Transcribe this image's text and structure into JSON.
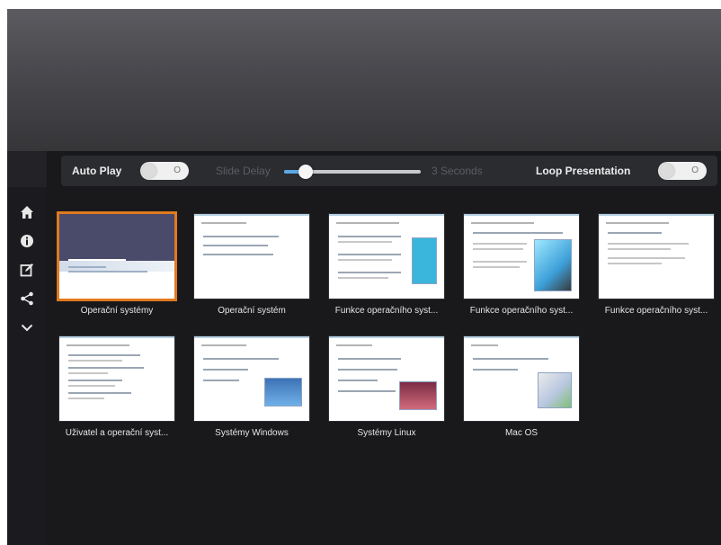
{
  "controls": {
    "auto_play_label": "Auto Play",
    "auto_play_state": "O",
    "slide_delay_label": "Slide Delay",
    "slide_delay_value": "3 Seconds",
    "slide_delay_level": 0.16,
    "loop_label": "Loop Presentation",
    "loop_state": "O"
  },
  "nav": {
    "items": [
      "home-icon",
      "info-icon",
      "edit-icon",
      "share-icon",
      "chevron-down-icon"
    ]
  },
  "slides": [
    {
      "caption": "Operační systémy",
      "selected": true
    },
    {
      "caption": "Operační systém"
    },
    {
      "caption": "Funkce operačního syst..."
    },
    {
      "caption": "Funkce operačního syst..."
    },
    {
      "caption": "Funkce operačního syst..."
    },
    {
      "caption": "Uživatel a operační syst..."
    },
    {
      "caption": "Systémy Windows"
    },
    {
      "caption": "Systémy Linux"
    },
    {
      "caption": "Mac OS"
    }
  ],
  "colors": {
    "accent_selected": "#e07a1e",
    "slider_fill": "#5aa8e6",
    "background": "#19191c"
  }
}
